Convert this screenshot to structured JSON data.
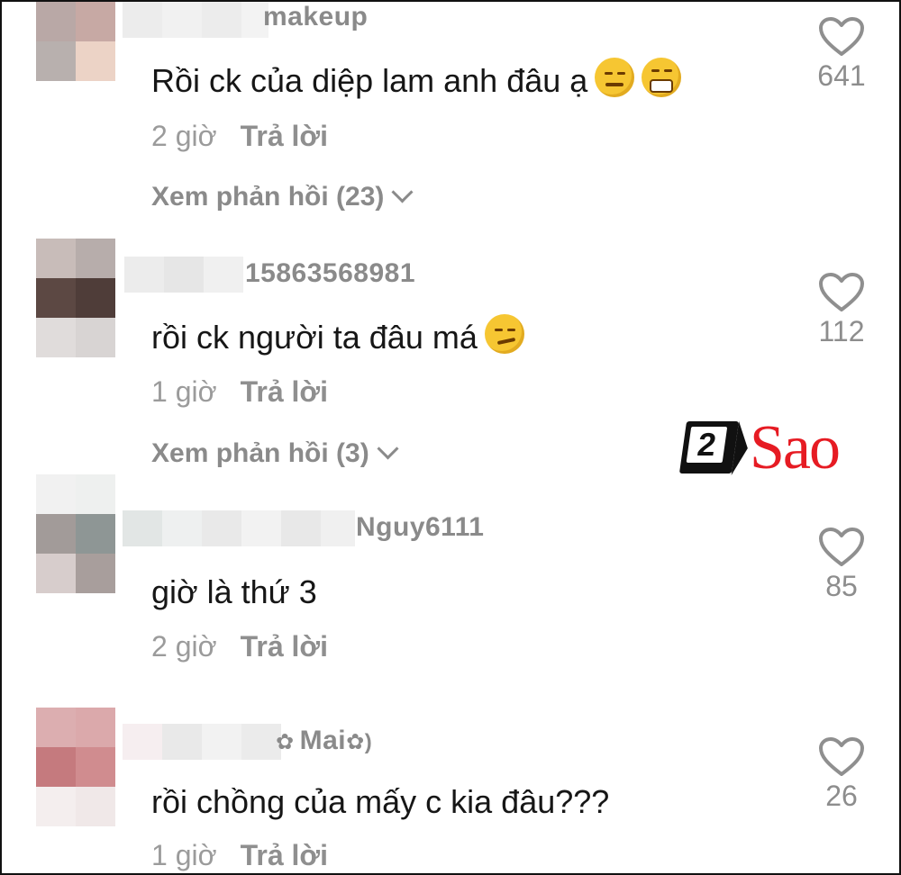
{
  "comments": [
    {
      "username": "makeup",
      "text": "Rồi ck của diệp lam anh đâu ạ",
      "emojis": [
        "relieved-face-emoji",
        "grimacing-face-emoji"
      ],
      "time": "2 giờ",
      "reply_label": "Trả lời",
      "view_replies": "Xem phản hồi (23)",
      "likes": "641",
      "avatar_colors": [
        "#b9a8a6",
        "#c7a9a4",
        "#b8b0ae",
        "#ecd3c6"
      ]
    },
    {
      "username": "15863568981",
      "text": "rồi ck người ta đâu má",
      "emojis": [
        "smirking-face-emoji"
      ],
      "time": "1 giờ",
      "reply_label": "Trả lời",
      "view_replies": "Xem phản hồi (3)",
      "likes": "112",
      "avatar_colors": [
        "#c8bcb9",
        "#b7adab",
        "#5c4843",
        "#4f3d39",
        "#e0dcdb",
        "#d8d4d3"
      ]
    },
    {
      "username": "Nguy6111",
      "text": "giờ là thứ 3",
      "emojis": [],
      "time": "2 giờ",
      "reply_label": "Trả lời",
      "likes": "85",
      "avatar_colors": [
        "#f1f1f1",
        "#eef0ef",
        "#a29b99",
        "#8e9695",
        "#d7cdcc",
        "#a89e9c"
      ]
    },
    {
      "username": "Mai",
      "text": "rồi chồng của mấy c kia đâu???",
      "emojis": [],
      "time": "1 giờ",
      "reply_label": "Trả lời",
      "likes": "26",
      "avatar_colors": [
        "#dcaeb0",
        "#dba9ab",
        "#c57a7e",
        "#d08c8f",
        "#f4eeee",
        "#f0e8e8"
      ]
    }
  ],
  "watermark": {
    "number": "2",
    "brand": "Sao",
    "color": "#e61b23"
  },
  "like_icon": "heart-outline-icon"
}
